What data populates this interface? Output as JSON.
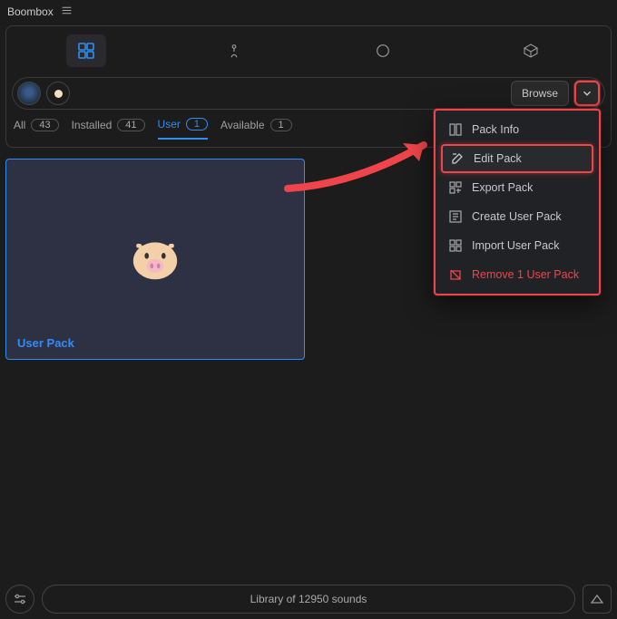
{
  "app_title": "Boombox",
  "toolbar": {
    "browse_label": "Browse"
  },
  "filters": [
    {
      "label": "All",
      "count": "43",
      "active": false
    },
    {
      "label": "Installed",
      "count": "41",
      "active": false
    },
    {
      "label": "User",
      "count": "1",
      "active": true
    },
    {
      "label": "Available",
      "count": "1",
      "active": false
    }
  ],
  "pack": {
    "label": "User Pack"
  },
  "context_menu": {
    "items": [
      {
        "label": "Pack Info",
        "icon": "book-icon"
      },
      {
        "label": "Edit Pack",
        "icon": "edit-icon",
        "selected": true
      },
      {
        "label": "Export Pack",
        "icon": "export-icon"
      },
      {
        "label": "Create User Pack",
        "icon": "create-icon"
      },
      {
        "label": "Import User Pack",
        "icon": "import-icon"
      },
      {
        "label": "Remove 1 User Pack",
        "icon": "remove-icon",
        "danger": true
      }
    ]
  },
  "footer": {
    "library_text": "Library of 12950 sounds"
  }
}
